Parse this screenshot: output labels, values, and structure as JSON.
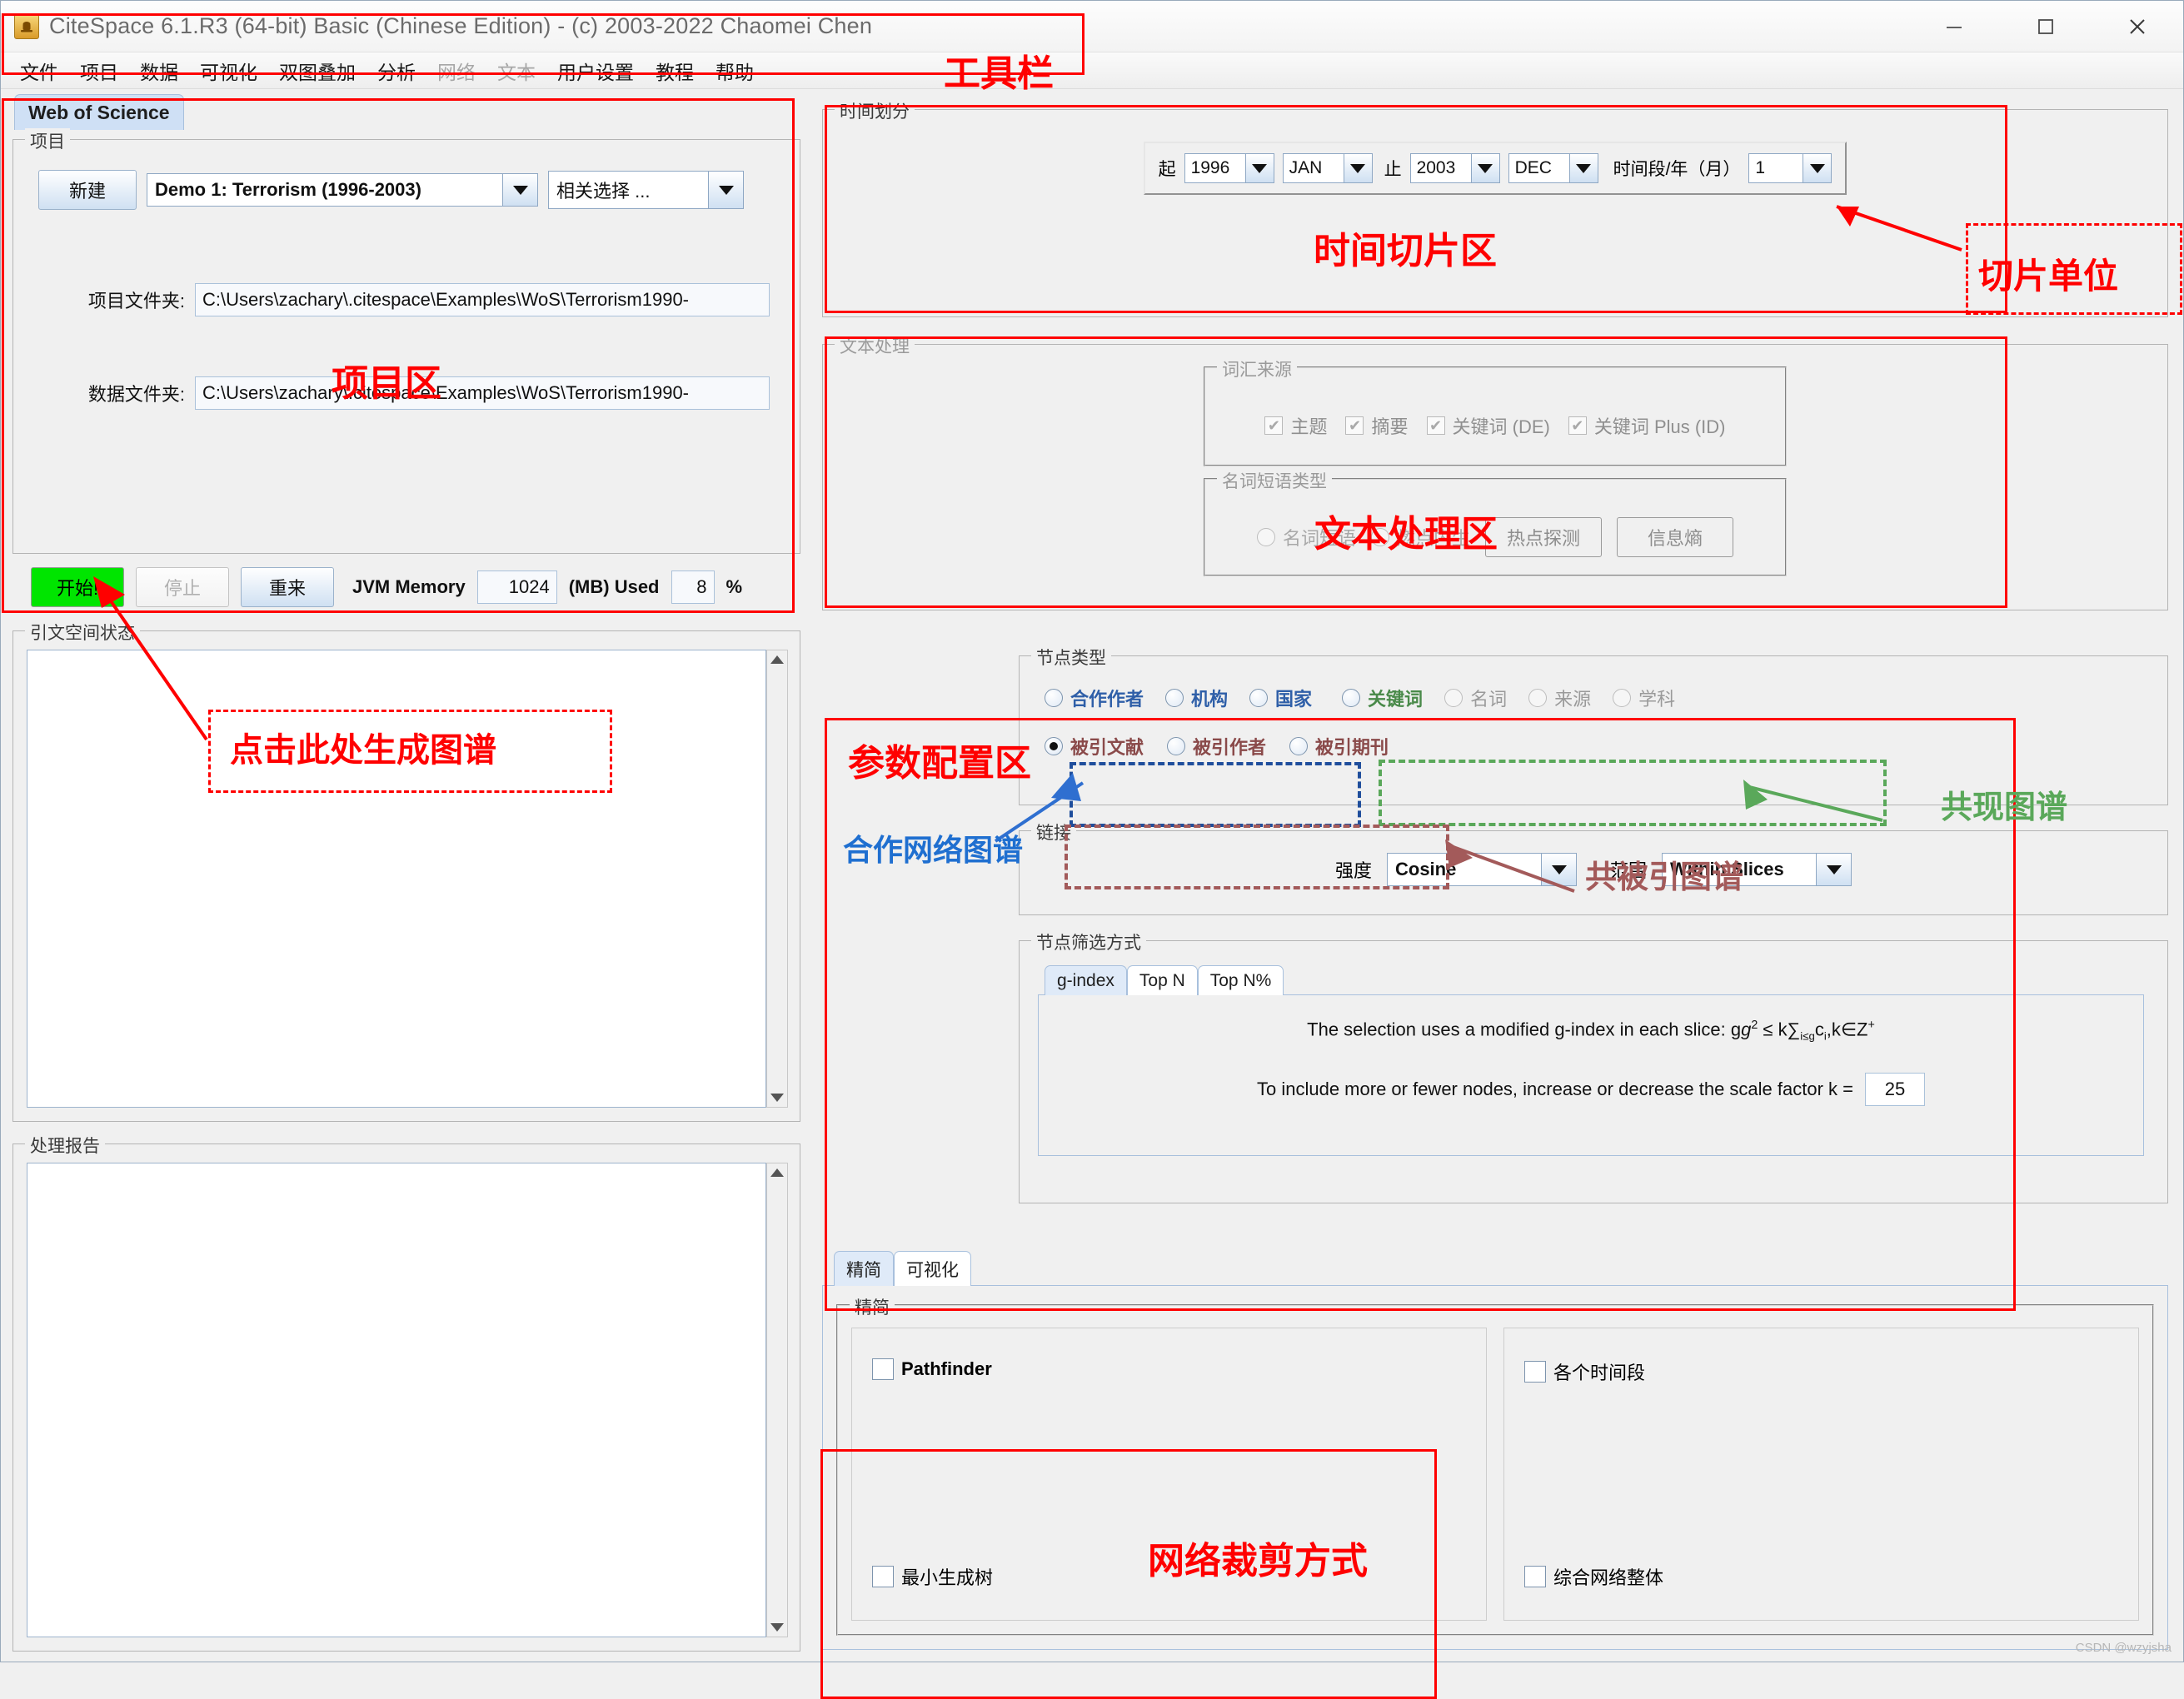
{
  "window": {
    "title": "CiteSpace 6.1.R3 (64-bit) Basic (Chinese Edition) - (c) 2003-2022 Chaomei Chen",
    "app_icon": "citespace-icon",
    "minimize": "–",
    "maximize": "□",
    "close": "✕"
  },
  "menu": {
    "items": [
      {
        "label": "文件",
        "disabled": false
      },
      {
        "label": "项目",
        "disabled": false
      },
      {
        "label": "数据",
        "disabled": false
      },
      {
        "label": "可视化",
        "disabled": false
      },
      {
        "label": "双图叠加",
        "disabled": false
      },
      {
        "label": "分析",
        "disabled": false
      },
      {
        "label": "网络",
        "disabled": true
      },
      {
        "label": "文本",
        "disabled": true
      },
      {
        "label": "用户设置",
        "disabled": false
      },
      {
        "label": "教程",
        "disabled": false
      },
      {
        "label": "帮助",
        "disabled": false
      }
    ]
  },
  "source_tab": {
    "label": "Web of Science"
  },
  "project": {
    "title": "项目",
    "new_button": "新建",
    "project_combo_value": "Demo 1: Terrorism (1996-2003)",
    "related_combo_value": "相关选择 ...",
    "project_folder_label": "项目文件夹:",
    "project_folder_value": "C:\\Users\\zachary\\.citespace\\Examples\\WoS\\Terrorism1990-",
    "data_folder_label": "数据文件夹:",
    "data_folder_value": "C:\\Users\\zachary\\.citespace\\Examples\\WoS\\Terrorism1990-"
  },
  "run": {
    "start": "开始!",
    "stop": "停止",
    "reset": "重来",
    "jvm_label": "JVM Memory",
    "jvm_value": "1024",
    "mb_used_label": "(MB) Used",
    "used_value": "8",
    "percent": "%"
  },
  "citation_status": {
    "title": "引文空间状态",
    "content": ""
  },
  "process_report": {
    "title": "处理报告",
    "content": ""
  },
  "time_slicing": {
    "title": "时间划分",
    "from_label": "起",
    "from_year": "1996",
    "from_month": "JAN",
    "to_label": "止",
    "to_year": "2003",
    "to_month": "DEC",
    "slice_label": "时间段/年（月）",
    "slice_value": "1"
  },
  "text_processing": {
    "title": "文本处理",
    "term_source": {
      "title": "词汇来源",
      "options": [
        {
          "label": "主题",
          "checked": true
        },
        {
          "label": "摘要",
          "checked": true
        },
        {
          "label": "关键词 (DE)",
          "checked": true
        },
        {
          "label": "关键词 Plus (ID)",
          "checked": true
        }
      ]
    },
    "noun_phrase": {
      "title": "名词短语类型",
      "options": [
        {
          "label": "名词短语",
          "selected": false
        },
        {
          "label": "燃点内生",
          "selected": false
        }
      ],
      "buttons": [
        "热点探测",
        "信息熵"
      ]
    }
  },
  "node_types": {
    "title": "节点类型",
    "row_collab": [
      {
        "label": "合作作者",
        "selected": false
      },
      {
        "label": "机构",
        "selected": false
      },
      {
        "label": "国家",
        "selected": false
      }
    ],
    "row_cooccur": [
      {
        "label": "关键词",
        "selected": false
      },
      {
        "label": "名词",
        "selected": false
      },
      {
        "label": "来源",
        "selected": false
      },
      {
        "label": "学科",
        "selected": false
      }
    ],
    "row_cocite": [
      {
        "label": "被引文献",
        "selected": true
      },
      {
        "label": "被引作者",
        "selected": false
      },
      {
        "label": "被引期刊",
        "selected": false
      }
    ]
  },
  "links": {
    "title": "链接",
    "strength_label": "强度",
    "strength_value": "Cosine",
    "scope_label": "范围",
    "scope_value": "Within Slices"
  },
  "node_selection": {
    "title": "节点筛选方式",
    "tabs": [
      {
        "label": "g-index",
        "selected": true
      },
      {
        "label": "Top N",
        "selected": false
      },
      {
        "label": "Top N%",
        "selected": false
      }
    ],
    "formula_prefix": "The selection uses a modified g-index in each slice: g",
    "formula_rest": " ≤ k∑",
    "formula_sub": "i≤g",
    "formula_c": "c",
    "formula_csub": "i",
    "formula_tail": ",k∈Z",
    "scale_text": "To include more or fewer nodes, increase or decrease the scale factor k =",
    "scale_value": "25"
  },
  "bottom_tabs": [
    {
      "label": "精简",
      "selected": true
    },
    {
      "label": "可视化",
      "selected": false
    }
  ],
  "pruning": {
    "title": "精简",
    "left_options": [
      {
        "label": "Pathfinder",
        "checked": false
      },
      {
        "label": "最小生成树",
        "checked": false
      }
    ],
    "right_options": [
      {
        "label": "各个时间段",
        "checked": false
      },
      {
        "label": "综合网络整体",
        "checked": false
      }
    ]
  },
  "annotations": {
    "toolbar": {
      "text": "工具栏",
      "color": "#ff0000"
    },
    "project_area": {
      "text": "项目区",
      "color": "#ff0000"
    },
    "click_here": {
      "text": "点击此处生成图谱",
      "color": "#ff0000"
    },
    "time_slice_area": {
      "text": "时间切片区",
      "color": "#ff0000"
    },
    "slice_unit": {
      "text": "切片单位",
      "color": "#ff0000"
    },
    "text_process_area": {
      "text": "文本处理区",
      "color": "#ff0000"
    },
    "param_config_area": {
      "text": "参数配置区",
      "color": "#ff0000"
    },
    "collab_network": {
      "text": "合作网络图谱",
      "color": "#1f6fd0"
    },
    "cooccur_map": {
      "text": "共现图谱",
      "color": "#5aa85a"
    },
    "cocite_map": {
      "text": "共被引图谱",
      "color": "#a35a5a"
    },
    "network_pruning": {
      "text": "网络裁剪方式",
      "color": "#ff0000"
    }
  },
  "watermark": "CSDN @wzyjsha"
}
